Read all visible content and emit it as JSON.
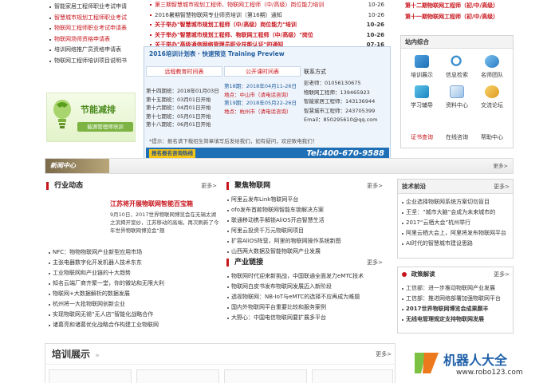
{
  "left_links": [
    {
      "text": "智能家居工程师职业考试申请",
      "style": "normal"
    },
    {
      "text": "智慧城市规划工程师职业考试",
      "style": "red"
    },
    {
      "text": "物联网工程师职业考试申请表",
      "style": "red"
    },
    {
      "text": "物联网场师资格申请表",
      "style": "red"
    },
    {
      "text": "培训网络推广员资格申请表",
      "style": "normal"
    },
    {
      "text": "物联网工程师培训项目说明书",
      "style": "normal"
    }
  ],
  "left_banner": {
    "title": "节能减排",
    "subtitle": "能源管理师培训"
  },
  "top_news": [
    {
      "text": "第三期智慧城市规划工程师、物联网工程师（中/高级）岗位能力培训",
      "date": "10-26",
      "style": "red"
    },
    {
      "text": "2016暑期智慧物联网专业师资培训（第16期）通知",
      "date": "10-26",
      "style": "normal"
    },
    {
      "text": "关于举办\"智慧城市规划工程师（中/高级）岗位能力\"培训",
      "date": "10-26",
      "style": "redbold"
    },
    {
      "text": "关于举办\"智慧城市规划工程师、物联网工程师（中/高级）\"岗位",
      "date": "10-26",
      "style": "redbold"
    },
    {
      "text": "关于举办\"高级通信网络管理员职业技能认证\"的通知",
      "date": "07-16",
      "style": "redbold"
    }
  ],
  "training": {
    "title": "2016培训计划表 · 快速预览 Training Preview",
    "col1_header": "远程教育时间表",
    "col2_header": "公开课时间表",
    "remote_rows": [
      "第十四期班：2018年01月03日",
      "第十五期班：03月01日开始",
      "第十六期班：04月01日开始",
      "第十七期班：05月01日开始",
      "第十八期班：06月01日开始"
    ],
    "public_rows": [
      "第18期：2018年04月11-26日",
      "地点：中山市（请电话咨询）",
      "第19期：2018年05月22-26日",
      "地点：杭州市（请电话咨询）"
    ],
    "contact_title": "联系方式",
    "contact_rows": [
      "彭老师：01056130675",
      "物联网工程师：139465923",
      "智能家居工程师：143136944",
      "智慧城市工程师：243705399",
      "Email：850295610@qq.com"
    ],
    "notice": "*提示：报名请下载招生简章填写后发给我们，如有疑问，欢迎致电我们！",
    "banner_left": "报名报名咨询热线",
    "phone": "Tel:400-670-9588"
  },
  "right_top": [
    {
      "text": "第十二期物联网工程师（初/中/高级）"
    },
    {
      "text": "第十一期物联网工程师（初/中/高级）"
    }
  ],
  "site_nav": {
    "title": "站内综合",
    "items": [
      "培训展示",
      "信息检索",
      "名师团队",
      "学习辅导",
      "资料中心",
      "交流论坛",
      "证书查询",
      "在线咨询",
      "帮助中心"
    ]
  },
  "news_center": {
    "label": "新闻中心",
    "more": "更多>"
  },
  "industry": {
    "title": "行业动态",
    "more": "更多>",
    "headline": "江苏将开展物联网智能百宝箱",
    "summary": "9月10日，2017世界物联网博览会在无锡太湖之滨揭开窒纱，江苏移动的高端，再次刷新了今年世界物联网博览会“翘",
    "items": [
      "NFC：物物物联网产业新型应用市场",
      "主张电器数字化开发机器人技术东东",
      "工业物联网和产业链的十大趋势",
      "知名云端厂商齐聚一堂，你的微站和无限大利",
      "物联网+大数据解析的数据发展",
      "杭州将一大批物联网创新企业",
      "实现物联网无锡“无人店”智能化战略合作",
      "诸葛亮和诸葛优化战略合作构建工业物联网"
    ]
  },
  "focus": {
    "title": "聚焦物联网",
    "more": "更多>",
    "items": [
      "阿里云发布Link物联网平台",
      "ofo发布首款物联网智能车锁解决方案",
      "联通移动携手解锁AliOS开启智慧生活",
      "阿里云投资千万元物联网项目",
      "扩容AliOS阵营，阿里的物联网操作系统新图",
      "山西两大数据及智能物联网产业发展"
    ]
  },
  "industry_chain": {
    "title": "产业链接",
    "more": "更多>",
    "items": [
      "物联网时代迎来新挑战，中国联通全面发力eMTC技术",
      "物联网白皮书发布物联网发展迈入新阶段",
      "透视物联网：NB-IoT与eMTC的选择不应再成为难题",
      "国内外物联网平台重要比较和服务案例",
      "大野心：中国电信物联网要扩展多平台"
    ]
  },
  "tech": {
    "title": "技术前沿",
    "more": "更多>",
    "items": [
      "企业选择物联网系统方案切勿盲目",
      "王坚：“城市大脑”会成为未来城市的",
      "2017“云栖大会”杭州举行",
      "阿里云栖大会上，阿里将发布物联网平台",
      "AI时代的智慧城市建设思路"
    ]
  },
  "policy": {
    "title": "政策解读",
    "more": "更多>",
    "items": [
      "工信部：进一步推动物联网产业发展",
      "工信部：推进网络部署加强物联网平台",
      "2017世界物联网博览会成果颇丰",
      "无线电管理规定支持物联网发展"
    ]
  },
  "training_show": {
    "title": "培训展示",
    "more": "更多>"
  },
  "watermark": {
    "brand": "机器人大全",
    "url": "www.robo123.com"
  }
}
